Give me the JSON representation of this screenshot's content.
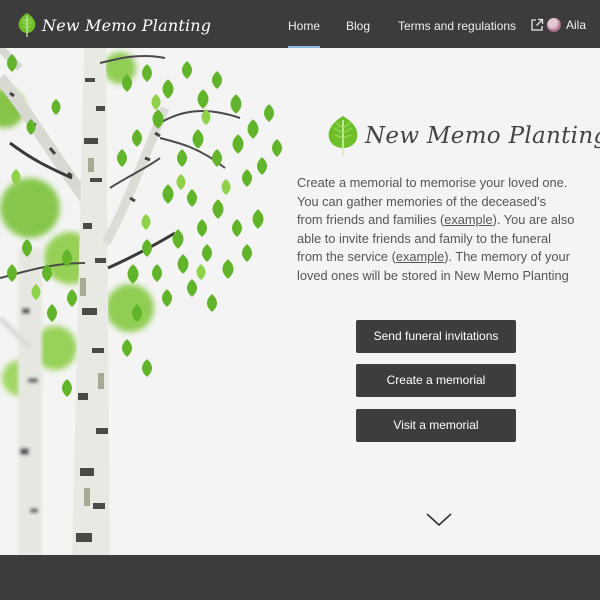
{
  "brand": {
    "name": "New Memo Planting",
    "leaf_color": "#6fbf2a"
  },
  "nav": {
    "items": [
      {
        "label": "Home",
        "active": true
      },
      {
        "label": "Blog",
        "active": false
      },
      {
        "label": "Terms and regulations",
        "active": false
      }
    ],
    "share_icon": "external-link-icon",
    "user": {
      "name": "Aila",
      "avatar_icon": "avatar-image"
    }
  },
  "hero": {
    "title": "New Memo Planting",
    "intro": {
      "t1": "Create a memorial to memorise your loved one. You can gather memories of the deceased’s from friends and families (",
      "link1": "example",
      "t2": "). You are also able to invite friends and family to the funeral from the service (",
      "link2": "example",
      "t3": "). The memory of your loved ones will be stored in New Memo Planting and"
    },
    "buttons": {
      "invitations": "Send funeral invitations",
      "create": "Create a memorial",
      "visit": "Visit a memorial"
    },
    "scroll_icon": "chevron-down-icon",
    "background_image": "birch-trees"
  },
  "colors": {
    "header_bg": "#3c3c3c",
    "button_bg": "#3d3d3d",
    "page_bg": "#f4f4f4",
    "active_underline": "#8fb7d9"
  }
}
